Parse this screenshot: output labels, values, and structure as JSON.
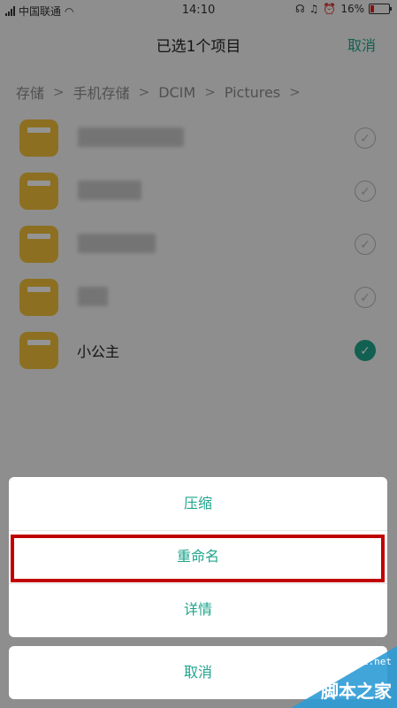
{
  "status_bar": {
    "carrier": "中国联通",
    "time": "14:10",
    "battery": "16%",
    "icons": [
      "signal-icon",
      "wifi-icon",
      "headset-icon",
      "mute-icon",
      "alarm-icon",
      "battery-icon"
    ]
  },
  "title_bar": {
    "title": "已选1个项目",
    "cancel_label": "取消"
  },
  "breadcrumb": {
    "items": [
      "存储",
      "手机存储",
      "DCIM",
      "Pictures"
    ],
    "separator": ">"
  },
  "file_list": {
    "items": [
      {
        "name": "",
        "selected": false
      },
      {
        "name": "",
        "selected": false
      },
      {
        "name": "",
        "selected": false
      },
      {
        "name": "",
        "selected": false
      },
      {
        "name": "小公主",
        "selected": true
      }
    ]
  },
  "action_sheet": {
    "items": [
      {
        "label": "压缩"
      },
      {
        "label": "重命名"
      },
      {
        "label": "详情"
      }
    ],
    "cancel_label": "取消"
  },
  "watermark": {
    "url": "jb51.net",
    "name": "脚本之家"
  },
  "colors": {
    "accent": "#20a58c",
    "folder": "#f2c03a",
    "highlight_border": "#c00000",
    "battery_low": "#e0201f",
    "watermark_bg": "#2e9bd6"
  }
}
